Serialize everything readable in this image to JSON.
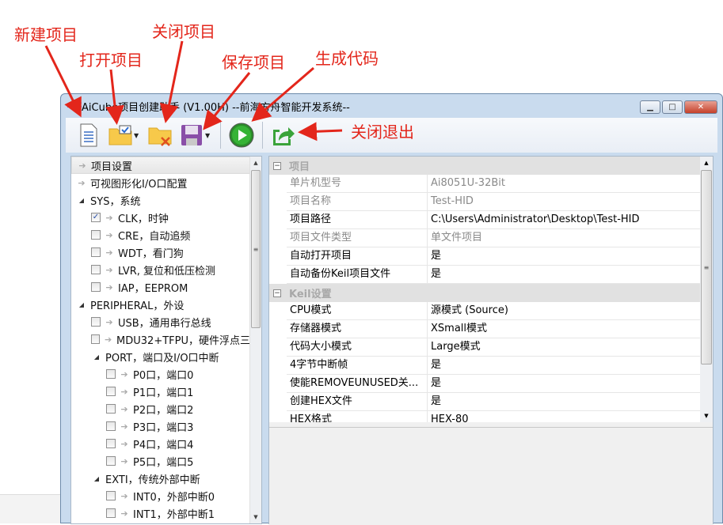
{
  "annotations": {
    "new_project": "新建项目",
    "open_project": "打开项目",
    "close_project": "关闭项目",
    "save_project": "保存项目",
    "generate_code": "生成代码",
    "close_exit": "关闭退出"
  },
  "window": {
    "title": "AiCube项目创建助手 (V1.00H)  --前海方舟智能开发系统--",
    "icon_text": "AiC"
  },
  "toolbar": {
    "icons": [
      "new-document-icon",
      "open-folder-icon",
      "close-folder-icon",
      "save-floppy-icon",
      "play-run-icon",
      "exit-share-icon"
    ]
  },
  "tree": [
    {
      "label": "项目设置",
      "kind": "arrow",
      "level": 0,
      "selected": true
    },
    {
      "label": "可视图形化I/O口配置",
      "kind": "arrow",
      "level": 0
    },
    {
      "label": "SYS，系统",
      "kind": "expand",
      "level": 0
    },
    {
      "label": "CLK，时钟",
      "kind": "check",
      "level": 1,
      "checked": true
    },
    {
      "label": "CRE，自动追频",
      "kind": "check",
      "level": 1
    },
    {
      "label": "WDT，看门狗",
      "kind": "check",
      "level": 1
    },
    {
      "label": "LVR, 复位和低压检测",
      "kind": "check",
      "level": 1
    },
    {
      "label": "IAP，EEPROM",
      "kind": "check",
      "level": 1
    },
    {
      "label": "PERIPHERAL，外设",
      "kind": "expand",
      "level": 0
    },
    {
      "label": "USB，通用串行总线",
      "kind": "check",
      "level": 1
    },
    {
      "label": "MDU32+TFPU，硬件浮点三",
      "kind": "check",
      "level": 1
    },
    {
      "label": "PORT，端口及I/O口中断",
      "kind": "expand",
      "level": 1
    },
    {
      "label": "P0口，端口0",
      "kind": "check",
      "level": 2
    },
    {
      "label": "P1口，端口1",
      "kind": "check",
      "level": 2
    },
    {
      "label": "P2口，端口2",
      "kind": "check",
      "level": 2
    },
    {
      "label": "P3口，端口3",
      "kind": "check",
      "level": 2
    },
    {
      "label": "P4口，端口4",
      "kind": "check",
      "level": 2
    },
    {
      "label": "P5口，端口5",
      "kind": "check",
      "level": 2
    },
    {
      "label": "EXTI，传统外部中断",
      "kind": "expand",
      "level": 1
    },
    {
      "label": "INT0，外部中断0",
      "kind": "check",
      "level": 2
    },
    {
      "label": "INT1，外部中断1",
      "kind": "check",
      "level": 2
    }
  ],
  "properties": [
    {
      "category": "项目",
      "rows": [
        {
          "key": "单片机型号",
          "value": "Ai8051U-32Bit",
          "readonly": true
        },
        {
          "key": "项目名称",
          "value": "Test-HID",
          "readonly": true
        },
        {
          "key": "项目路径",
          "value": "C:\\Users\\Administrator\\Desktop\\Test-HID"
        },
        {
          "key": "项目文件类型",
          "value": "单文件项目",
          "readonly": true
        },
        {
          "key": "自动打开项目",
          "value": "是"
        },
        {
          "key": "自动备份Keil项目文件",
          "value": "是"
        }
      ]
    },
    {
      "category": "Keil设置",
      "rows": [
        {
          "key": "CPU模式",
          "value": "源模式 (Source)"
        },
        {
          "key": "存储器模式",
          "value": "XSmall模式"
        },
        {
          "key": "代码大小模式",
          "value": "Large模式"
        },
        {
          "key": "4字节中断帧",
          "value": "是"
        },
        {
          "key": "使能REMOVEUNUSED关...",
          "value": "是"
        },
        {
          "key": "创建HEX文件",
          "value": "是"
        },
        {
          "key": "HEX格式",
          "value": "HEX-80"
        }
      ]
    }
  ],
  "colors": {
    "annotation": "#e3261b",
    "run_green": "#1f9a1f"
  }
}
